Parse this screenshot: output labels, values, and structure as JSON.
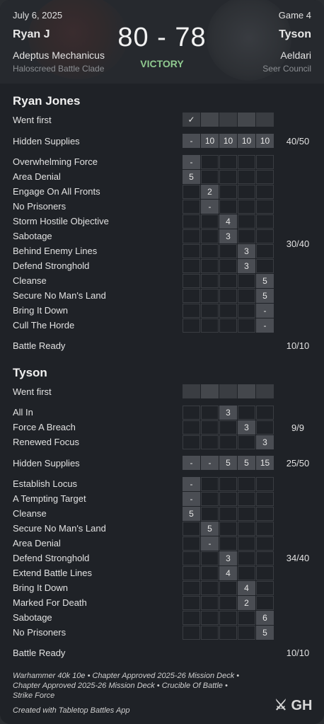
{
  "header": {
    "date": "July 6, 2025",
    "game": "Game 4",
    "player1": "Ryan J",
    "player2": "Tyson",
    "score": "80 - 78",
    "faction1": "Adeptus Mechanicus",
    "faction2": "Aeldari",
    "subfaction1": "Haloscreed Battle Clade",
    "subfaction2": "Seer Council",
    "result": "VICTORY"
  },
  "p1": {
    "name": "Ryan Jones",
    "went_first_label": "Went first",
    "went_first_mark": "✓",
    "hidden_label": "Hidden Supplies",
    "hidden_values": [
      "-",
      "10",
      "10",
      "10",
      "10"
    ],
    "hidden_total": "40/50",
    "secondaries": [
      {
        "name": "Overwhelming Force",
        "round": 0,
        "value": "-"
      },
      {
        "name": "Area Denial",
        "round": 0,
        "value": "5"
      },
      {
        "name": "Engage On All Fronts",
        "round": 1,
        "value": "2"
      },
      {
        "name": "No Prisoners",
        "round": 1,
        "value": "-"
      },
      {
        "name": "Storm Hostile Objective",
        "round": 2,
        "value": "4"
      },
      {
        "name": "Sabotage",
        "round": 2,
        "value": "3"
      },
      {
        "name": "Behind Enemy Lines",
        "round": 3,
        "value": "3"
      },
      {
        "name": "Defend Stronghold",
        "round": 3,
        "value": "3"
      },
      {
        "name": "Cleanse",
        "round": 4,
        "value": "5"
      },
      {
        "name": "Secure No Man's Land",
        "round": 4,
        "value": "5"
      },
      {
        "name": "Bring It Down",
        "round": 4,
        "value": "-"
      },
      {
        "name": "Cull The Horde",
        "round": 4,
        "value": "-"
      }
    ],
    "secondary_total": "30/40",
    "battle_ready_label": "Battle Ready",
    "battle_ready_total": "10/10"
  },
  "p2": {
    "name": "Tyson",
    "went_first_label": "Went first",
    "gambits": [
      {
        "name": "All In",
        "round": 2,
        "value": "3"
      },
      {
        "name": "Force A Breach",
        "round": 3,
        "value": "3"
      },
      {
        "name": "Renewed Focus",
        "round": 4,
        "value": "3"
      }
    ],
    "gambit_total": "9/9",
    "hidden_label": "Hidden Supplies",
    "hidden_values": [
      "-",
      "-",
      "5",
      "5",
      "15"
    ],
    "hidden_total": "25/50",
    "secondaries": [
      {
        "name": "Establish Locus",
        "round": 0,
        "value": "-"
      },
      {
        "name": "A Tempting Target",
        "round": 0,
        "value": "-"
      },
      {
        "name": "Cleanse",
        "round": 0,
        "value": "5"
      },
      {
        "name": "Secure No Man's Land",
        "round": 1,
        "value": "5"
      },
      {
        "name": "Area Denial",
        "round": 1,
        "value": "-"
      },
      {
        "name": "Defend Stronghold",
        "round": 2,
        "value": "3"
      },
      {
        "name": "Extend Battle Lines",
        "round": 2,
        "value": "4"
      },
      {
        "name": "Bring It Down",
        "round": 3,
        "value": "4"
      },
      {
        "name": "Marked For Death",
        "round": 3,
        "value": "2"
      },
      {
        "name": "Sabotage",
        "round": 4,
        "value": "6"
      },
      {
        "name": "No Prisoners",
        "round": 4,
        "value": "5"
      }
    ],
    "secondary_total": "34/40",
    "battle_ready_label": "Battle Ready",
    "battle_ready_total": "10/10"
  },
  "footer": {
    "line1": "Warhammer 40k 10e • Chapter Approved 2025-26 Mission Deck •",
    "line2": "Chapter Approved 2025-26 Mission Deck • Crucible Of Battle •",
    "line3": "Strike Force",
    "credit": "Created with Tabletop Battles App",
    "logo": "⚔ GH"
  },
  "colors": {
    "background": "#1f2227",
    "cell_filled": "#4a4d53",
    "cell_border": "#3a3d42",
    "victory": "#8fc98f"
  }
}
